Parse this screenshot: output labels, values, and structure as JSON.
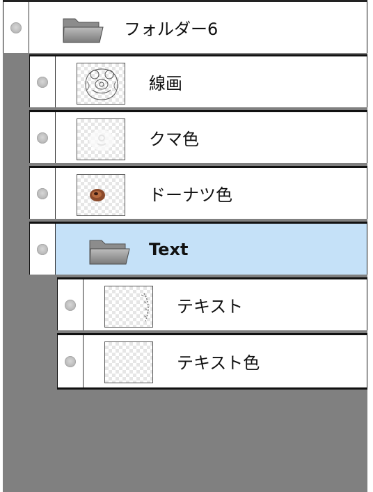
{
  "layers": [
    {
      "name": "フォルダー6",
      "type": "folder"
    },
    {
      "name": "線画",
      "type": "layer",
      "thumb": "lineart-thumbnail"
    },
    {
      "name": "クマ色",
      "type": "layer",
      "thumb": "bear-color-thumbnail"
    },
    {
      "name": "ドーナツ色",
      "type": "layer",
      "thumb": "donut-color-thumbnail"
    },
    {
      "name": "Text",
      "type": "folder",
      "selected": true
    },
    {
      "name": "テキスト",
      "type": "layer",
      "thumb": "text-thumbnail"
    },
    {
      "name": "テキスト色",
      "type": "layer",
      "thumb": "text-color-thumbnail"
    }
  ],
  "colors": {
    "selected_row": "#c5e1f8",
    "panel_background": "#808080",
    "donut_brown": "#8b4a2b"
  }
}
